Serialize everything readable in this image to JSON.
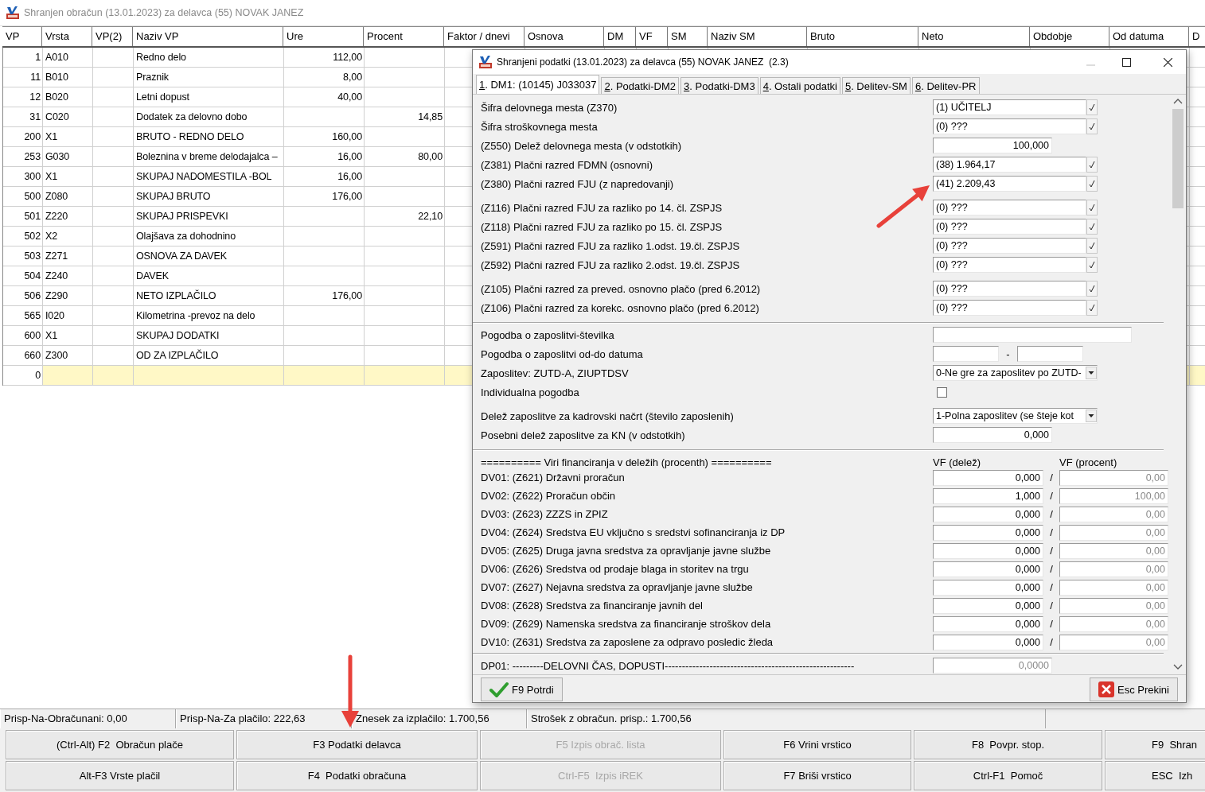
{
  "window": {
    "title": "Shranjen obračun (13.01.2023) za delavca (55) NOVAK JANEZ"
  },
  "table": {
    "columns": [
      "VP",
      "Vrsta",
      "VP(2)",
      "Naziv VP",
      "Ure",
      "Procent",
      "Faktor / dnevi",
      "Osnova",
      "DM",
      "VF",
      "SM",
      "Naziv SM",
      "Bruto",
      "Neto",
      "Obdobje",
      "Od datuma",
      "D"
    ],
    "rows": [
      {
        "vp": "1",
        "vrsta": "A010",
        "naziv": "Redno delo",
        "ure": "112,00",
        "selected": false
      },
      {
        "vp": "11",
        "vrsta": "B010",
        "naziv": "Praznik",
        "ure": "8,00",
        "selected": false
      },
      {
        "vp": "12",
        "vrsta": "B020",
        "naziv": "Letni dopust",
        "ure": "40,00",
        "selected": false
      },
      {
        "vp": "31",
        "vrsta": "C020",
        "naziv": "Dodatek za delovno dobo",
        "procent": "14,85",
        "selected": false
      },
      {
        "vp": "200",
        "vrsta": "X1",
        "naziv": "BRUTO - REDNO DELO",
        "ure": "160,00",
        "selected": false
      },
      {
        "vp": "253",
        "vrsta": "G030",
        "naziv": "Boleznina v breme delodajalca –",
        "ure": "16,00",
        "procent": "80,00",
        "selected": false
      },
      {
        "vp": "300",
        "vrsta": "X1",
        "naziv": "SKUPAJ NADOMESTILA -BOL",
        "ure": "16,00",
        "selected": false
      },
      {
        "vp": "500",
        "vrsta": "Z080",
        "naziv": "SKUPAJ BRUTO",
        "ure": "176,00",
        "selected": false
      },
      {
        "vp": "501",
        "vrsta": "Z220",
        "naziv": "SKUPAJ PRISPEVKI",
        "procent": "22,10",
        "selected": false
      },
      {
        "vp": "502",
        "vrsta": "X2",
        "naziv": "Olajšava za dohodnino",
        "selected": false
      },
      {
        "vp": "503",
        "vrsta": "Z271",
        "naziv": "OSNOVA ZA DAVEK",
        "selected": false
      },
      {
        "vp": "504",
        "vrsta": "Z240",
        "naziv": "DAVEK",
        "selected": false
      },
      {
        "vp": "506",
        "vrsta": "Z290",
        "naziv": "NETO IZPLAČILO",
        "ure": "176,00",
        "selected": false
      },
      {
        "vp": "565",
        "vrsta": "I020",
        "naziv": "Kilometrina -prevoz na delo",
        "selected": false
      },
      {
        "vp": "600",
        "vrsta": "X1",
        "naziv": "SKUPAJ DODATKI",
        "selected": false
      },
      {
        "vp": "660",
        "vrsta": "Z300",
        "naziv": "OD ZA IZPLAČILO",
        "selected": false
      },
      {
        "vp": "0",
        "selected": true
      }
    ]
  },
  "dialog": {
    "title": "Shranjeni podatki (13.01.2023) za delavca (55) NOVAK JANEZ  (2.3)",
    "tabs": [
      {
        "label": "1. DM1: (10145) J033037",
        "selected": true
      },
      {
        "label": "2. Podatki-DM2",
        "selected": false
      },
      {
        "label": "3. Podatki-DM3",
        "selected": false
      },
      {
        "label": "4. Ostali podatki",
        "selected": false
      },
      {
        "label": "5. Delitev-SM",
        "selected": false
      },
      {
        "label": "6. Delitev-PR",
        "selected": false
      }
    ],
    "sections": [
      {
        "groups": [
          [
            {
              "kind": "lookup",
              "label": "Šifra delovnega mesta (Z370)",
              "value": "(1) UČITELJ"
            },
            {
              "kind": "lookup",
              "label": "Šifra stroškovnega mesta",
              "value": "(0) ???"
            },
            {
              "kind": "number",
              "label": "(Z550) Delež delovnega mesta (v odstotkih)",
              "value": "100,000"
            },
            {
              "kind": "lookup",
              "label": "(Z381) Plačni razred FDMN (osnovni)",
              "value": "(38) 1.964,17"
            },
            {
              "kind": "lookup",
              "label": "(Z380) Plačni razred FJU (z napredovanji)",
              "value": "(41) 2.209,43"
            }
          ],
          [
            {
              "kind": "lookup",
              "label": "(Z116) Plačni razred FJU za razliko po 14. čl. ZSPJS",
              "value": "(0) ???"
            },
            {
              "kind": "lookup",
              "label": "(Z118) Plačni razred FJU za razliko po 15. čl. ZSPJS",
              "value": "(0) ???"
            },
            {
              "kind": "lookup",
              "label": "(Z591) Plačni razred FJU za razliko 1.odst. 19.čl. ZSPJS",
              "value": "(0) ???"
            },
            {
              "kind": "lookup",
              "label": "(Z592) Plačni razred FJU za razliko 2.odst. 19.čl. ZSPJS",
              "value": "(0) ???"
            }
          ],
          [
            {
              "kind": "lookup",
              "label": "(Z105) Plačni razred za preved. osnovno plačo (pred 6.2012)",
              "value": "(0) ???"
            },
            {
              "kind": "lookup",
              "label": "(Z106) Plačni razred za korekc. osnovno plačo (pred 6.2012)",
              "value": "(0) ???"
            }
          ]
        ]
      },
      {
        "groups": [
          [
            {
              "kind": "text",
              "label": "Pogodba o zaposlitvi-številka"
            },
            {
              "kind": "daterange",
              "label": "Pogodba o zaposlitvi od-do datuma",
              "separator": "-"
            },
            {
              "kind": "dropdown",
              "label": "Zaposlitev: ZUTD-A, ZIUPTDSV",
              "value": "0-Ne gre za zaposlitev po ZUTD-"
            },
            {
              "kind": "checkbox",
              "label": "Individualna pogodba",
              "checked": false
            }
          ],
          [
            {
              "kind": "dropdown",
              "label": "Delež zaposlitve za kadrovski načrt (število zaposlenih)",
              "value": "1-Polna zaposlitev (se šteje kot"
            },
            {
              "kind": "number",
              "label": "Posebni delež zaposlitve za KN (v odstotkih)",
              "value": "0,000"
            }
          ]
        ]
      }
    ],
    "financing": {
      "heading": "========== Viri financiranja v deležih (procenth) ==========",
      "share_header": "VF (delež)",
      "percent_header": "VF (procent)",
      "rows": [
        {
          "label": "DV01: (Z621) Državni proračun",
          "share": "0,000",
          "slash": "/",
          "percent": "0,00"
        },
        {
          "label": "DV02: (Z622) Proračun občin",
          "share": "1,000",
          "slash": "/",
          "percent": "100,00"
        },
        {
          "label": "DV03: (Z623) ZZZS in ZPIZ",
          "share": "0,000",
          "slash": "/",
          "percent": "0,00"
        },
        {
          "label": "DV04: (Z624) Sredstva EU vključno s sredstvi sofinanciranja iz DP",
          "share": "0,000",
          "slash": "/",
          "percent": "0,00"
        },
        {
          "label": "DV05: (Z625) Druga javna sredstva za opravljanje javne službe",
          "share": "0,000",
          "slash": "/",
          "percent": "0,00"
        },
        {
          "label": "DV06: (Z626) Sredstva od prodaje blaga in storitev na trgu",
          "share": "0,000",
          "slash": "/",
          "percent": "0,00"
        },
        {
          "label": "DV07: (Z627) Nejavna sredstva za opravljanje javne službe",
          "share": "0,000",
          "slash": "/",
          "percent": "0,00"
        },
        {
          "label": "DV08: (Z628) Sredstva za financiranje javnih del",
          "share": "0,000",
          "slash": "/",
          "percent": "0,00"
        },
        {
          "label": "DV09: (Z629) Namenska sredstva za financiranje stroškov dela",
          "share": "0,000",
          "slash": "/",
          "percent": "0,00"
        },
        {
          "label": "DV10: (Z631) Sredstva za zaposlene za odpravo posledic žleda",
          "share": "0,000",
          "slash": "/",
          "percent": "0,00"
        }
      ]
    },
    "last_row": {
      "label": "DP01: ---------DELOVNI ČAS, DOPUSTI-------------------------------------------------------",
      "value": "0,0000"
    },
    "buttons": [
      {
        "kind": "confirm",
        "label": "F9 Potrdi"
      },
      {
        "kind": "cancel",
        "label": "Esc Prekini"
      }
    ]
  },
  "status_bar": [
    "Prisp-Na-Obračunani: 0,00",
    "Prisp-Na-Za plačilo: 222,63",
    "Znesek za izplačilo: 1.700,56",
    "Strošek z obračun. prisp.: 1.700,56"
  ],
  "buttons": [
    [
      {
        "label": "(Ctrl-Alt) F2  Obračun plače",
        "disabled": false
      },
      {
        "label": "F3 Podatki delavca",
        "disabled": false
      },
      {
        "label": "F5 Izpis obrač. lista",
        "disabled": true
      },
      {
        "label": "F6 Vrini vrstico",
        "disabled": false
      },
      {
        "label": "F8  Povpr. stop.",
        "disabled": false
      },
      {
        "label": "F9  Shran",
        "disabled": false
      }
    ],
    [
      {
        "label": "Alt-F3 Vrste plačil",
        "disabled": false
      },
      {
        "label": "F4  Podatki obračuna",
        "disabled": false
      },
      {
        "label": "Ctrl-F5  Izpis iREK",
        "disabled": true
      },
      {
        "label": "F7 Briši vrstico",
        "disabled": false
      },
      {
        "label": "Ctrl-F1  Pomoč",
        "disabled": false
      },
      {
        "label": "ESC  Izh",
        "disabled": false
      }
    ]
  ]
}
